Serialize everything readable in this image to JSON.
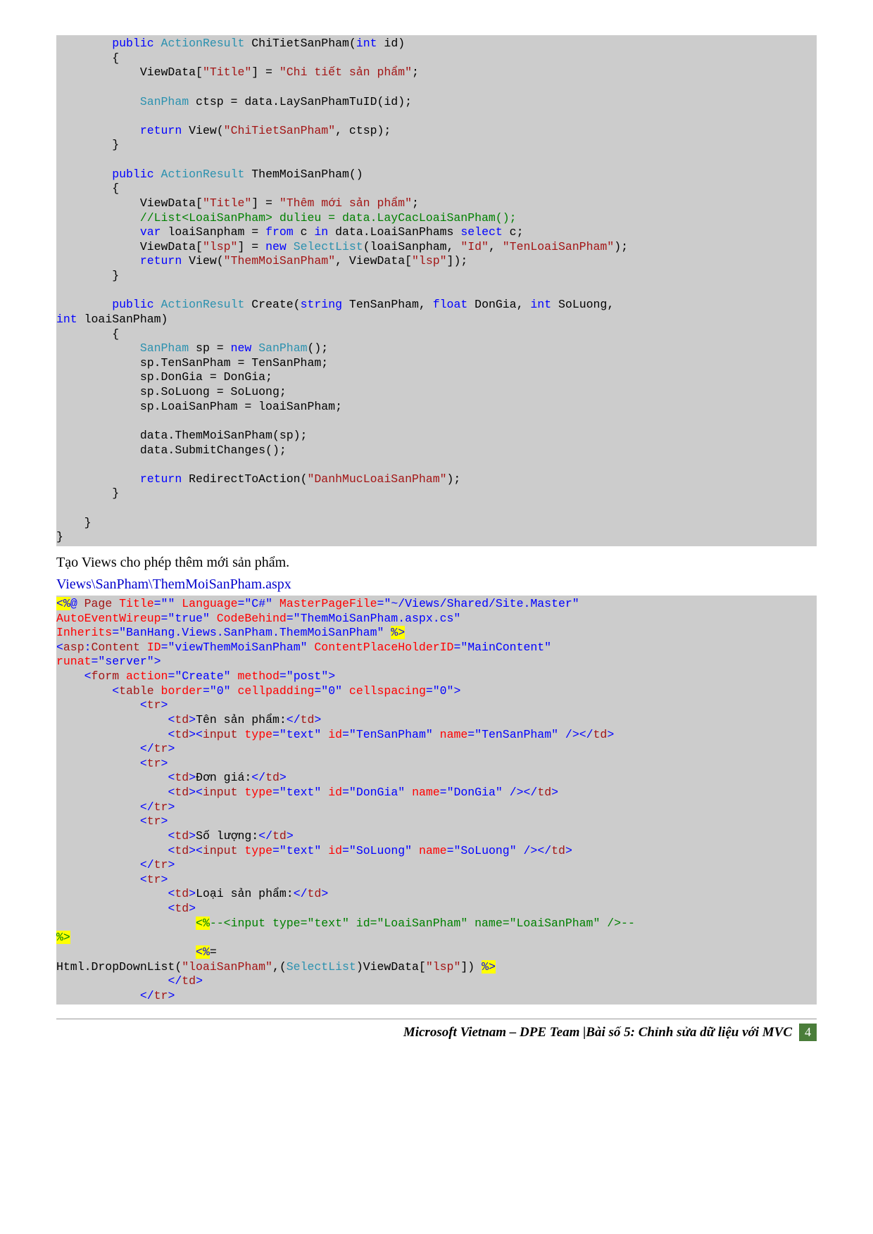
{
  "code1": {
    "l1a": "public",
    "l1b": "ActionResult",
    "l1c": " ChiTietSanPham(",
    "l1d": "int",
    "l1e": " id)",
    "l2": "        {",
    "l3a": "            ViewData[",
    "l3b": "\"Title\"",
    "l3c": "] = ",
    "l3d": "\"Chi tiết sản phẩm\"",
    "l3e": ";",
    "l4a": "            ",
    "l4b": "SanPham",
    "l4c": " ctsp = data.LaySanPhamTuID(id);",
    "l5a": "            ",
    "l5b": "return",
    "l5c": " View(",
    "l5d": "\"ChiTietSanPham\"",
    "l5e": ", ctsp);",
    "l6": "        }",
    "l7a": "        ",
    "l7b": "public",
    "l7c": " ",
    "l7d": "ActionResult",
    "l7e": " ThemMoiSanPham()",
    "l8": "        {",
    "l9a": "            ViewData[",
    "l9b": "\"Title\"",
    "l9c": "] = ",
    "l9d": "\"Thêm mới sản phẩm\"",
    "l9e": ";",
    "l10a": "            ",
    "l10b": "//List<LoaiSanPham> dulieu = data.LayCacLoaiSanPham();",
    "l11a": "            ",
    "l11b": "var",
    "l11c": " loaiSanpham = ",
    "l11d": "from",
    "l11e": " c ",
    "l11f": "in",
    "l11g": " data.LoaiSanPhams ",
    "l11h": "select",
    "l11i": " c;",
    "l12a": "            ViewData[",
    "l12b": "\"lsp\"",
    "l12c": "] = ",
    "l12d": "new",
    "l12e": " ",
    "l12f": "SelectList",
    "l12g": "(loaiSanpham, ",
    "l12h": "\"Id\"",
    "l12i": ", ",
    "l12j": "\"TenLoaiSanPham\"",
    "l12k": ");",
    "l13a": "            ",
    "l13b": "return",
    "l13c": " View(",
    "l13d": "\"ThemMoiSanPham\"",
    "l13e": ", ViewData[",
    "l13f": "\"lsp\"",
    "l13g": "]);",
    "l14": "        }",
    "l15a": "        ",
    "l15b": "public",
    "l15c": " ",
    "l15d": "ActionResult",
    "l15e": " Create(",
    "l15f": "string",
    "l15g": " TenSanPham, ",
    "l15h": "float",
    "l15i": " DonGia, ",
    "l15j": "int",
    "l15k": " SoLuong, ",
    "l16a": "int",
    "l16b": " loaiSanPham)",
    "l17": "        {",
    "l18a": "            ",
    "l18b": "SanPham",
    "l18c": " sp = ",
    "l18d": "new",
    "l18e": " ",
    "l18f": "SanPham",
    "l18g": "();",
    "l19": "            sp.TenSanPham = TenSanPham;",
    "l20": "            sp.DonGia = DonGia;",
    "l21": "            sp.SoLuong = SoLuong;",
    "l22": "            sp.LoaiSanPham = loaiSanPham;",
    "l23": "            data.ThemMoiSanPham(sp);",
    "l24": "            data.SubmitChanges();",
    "l25a": "            ",
    "l25b": "return",
    "l25c": " RedirectToAction(",
    "l25d": "\"DanhMucLoaiSanPham\"",
    "l25e": ");",
    "l26": "        }",
    "l27": "    }",
    "l28": "}"
  },
  "text1": "Tạo Views cho phép thêm mới sản phẩm.",
  "filepath": "Views\\SanPham\\ThemMoiSanPham.aspx",
  "code2": {
    "r1a": "<%",
    "r1b": "@",
    "r1c": " ",
    "r1d": "Page",
    "r1e": " ",
    "r1f": "Title",
    "r1g": "=\"\"",
    "r1h": " ",
    "r1i": "Language",
    "r1j": "=\"C#\"",
    "r1k": " ",
    "r1l": "MasterPageFile",
    "r1m": "=\"~/Views/Shared/Site.Master\"",
    "r2a": "AutoEventWireup",
    "r2b": "=\"true\"",
    "r2c": " ",
    "r2d": "CodeBehind",
    "r2e": "=\"ThemMoiSanPham.aspx.cs\"",
    "r3a": "Inherits",
    "r3b": "=\"BanHang.Views.SanPham.ThemMoiSanPham\"",
    "r3c": " ",
    "r3d": "%>",
    "r4a": "<",
    "r4b": "asp",
    "r4c": ":",
    "r4d": "Content",
    "r4e": " ",
    "r4f": "ID",
    "r4g": "=\"viewThemMoiSanPham\"",
    "r4h": " ",
    "r4i": "ContentPlaceHolderID",
    "r4j": "=\"MainContent\"",
    "r5a": "runat",
    "r5b": "=\"server\">",
    "r6a": "    ",
    "r6b": "<",
    "r6c": "form",
    "r6d": " ",
    "r6e": "action",
    "r6f": "=\"Create\"",
    "r6g": " ",
    "r6h": "method",
    "r6i": "=\"post\">",
    "r7a": "        ",
    "r7b": "<",
    "r7c": "table",
    "r7d": " ",
    "r7e": "border",
    "r7f": "=\"0\"",
    "r7g": " ",
    "r7h": "cellpadding",
    "r7i": "=\"0\"",
    "r7j": " ",
    "r7k": "cellspacing",
    "r7l": "=\"0\">",
    "r8a": "            ",
    "r8b": "<",
    "r8c": "tr",
    "r8d": ">",
    "r9a": "                ",
    "r9b": "<",
    "r9c": "td",
    "r9d": ">",
    "r9e": "Tên sản phẩm:",
    "r9f": "</",
    "r9g": "td",
    "r9h": ">",
    "r10a": "                ",
    "r10b": "<",
    "r10c": "td",
    "r10d": "><",
    "r10e": "input",
    "r10f": " ",
    "r10g": "type",
    "r10h": "=\"text\"",
    "r10i": " ",
    "r10j": "id",
    "r10k": "=\"TenSanPham\"",
    "r10l": " ",
    "r10m": "name",
    "r10n": "=\"TenSanPham\"",
    "r10o": " ",
    "r10p": "/></",
    "r10q": "td",
    "r10r": ">",
    "r11a": "            ",
    "r11b": "</",
    "r11c": "tr",
    "r11d": ">",
    "r12a": "            ",
    "r12b": "<",
    "r12c": "tr",
    "r12d": ">",
    "r13a": "                ",
    "r13b": "<",
    "r13c": "td",
    "r13d": ">",
    "r13e": "Đơn giá:",
    "r13f": "</",
    "r13g": "td",
    "r13h": ">",
    "r14a": "                ",
    "r14b": "<",
    "r14c": "td",
    "r14d": "><",
    "r14e": "input",
    "r14f": " ",
    "r14g": "type",
    "r14h": "=\"text\"",
    "r14i": " ",
    "r14j": "id",
    "r14k": "=\"DonGia\"",
    "r14l": " ",
    "r14m": "name",
    "r14n": "=\"DonGia\"",
    "r14o": " ",
    "r14p": "/></",
    "r14q": "td",
    "r14r": ">",
    "r15a": "            ",
    "r15b": "</",
    "r15c": "tr",
    "r15d": ">",
    "r16a": "            ",
    "r16b": "<",
    "r16c": "tr",
    "r16d": ">",
    "r17a": "                ",
    "r17b": "<",
    "r17c": "td",
    "r17d": ">",
    "r17e": "Số lượng:",
    "r17f": "</",
    "r17g": "td",
    "r17h": ">",
    "r18a": "                ",
    "r18b": "<",
    "r18c": "td",
    "r18d": "><",
    "r18e": "input",
    "r18f": " ",
    "r18g": "type",
    "r18h": "=\"text\"",
    "r18i": " ",
    "r18j": "id",
    "r18k": "=\"SoLuong\"",
    "r18l": " ",
    "r18m": "name",
    "r18n": "=\"SoLuong\"",
    "r18o": " ",
    "r18p": "/></",
    "r18q": "td",
    "r18r": ">",
    "r19a": "            ",
    "r19b": "</",
    "r19c": "tr",
    "r19d": ">",
    "r20a": "            ",
    "r20b": "<",
    "r20c": "tr",
    "r20d": ">",
    "r21a": "                ",
    "r21b": "<",
    "r21c": "td",
    "r21d": ">",
    "r21e": "Loại sản phẩm:",
    "r21f": "</",
    "r21g": "td",
    "r21h": ">",
    "r22a": "                ",
    "r22b": "<",
    "r22c": "td",
    "r22d": ">",
    "r23a": "                    ",
    "r23b": "<%",
    "r23c": "--<input type=\"text\" id=\"LoaiSanPham\" name=\"LoaiSanPham\" />--",
    "r24a": "%>",
    "r25a": "                    ",
    "r25b": "<%",
    "r25c": "=",
    "r26a": "Html.DropDownList(",
    "r26b": "\"loaiSanPham\"",
    "r26c": ",(",
    "r26d": "SelectList",
    "r26e": ")ViewData[",
    "r26f": "\"lsp\"",
    "r26g": "]) ",
    "r26h": "%>",
    "r27a": "                ",
    "r27b": "</",
    "r27c": "td",
    "r27d": ">",
    "r28a": "            ",
    "r28b": "</",
    "r28c": "tr",
    "r28d": ">"
  },
  "footer": {
    "text": "Microsoft Vietnam – DPE Team |Bài số 5: Chỉnh sửa dữ liệu với MVC",
    "page": "4"
  }
}
